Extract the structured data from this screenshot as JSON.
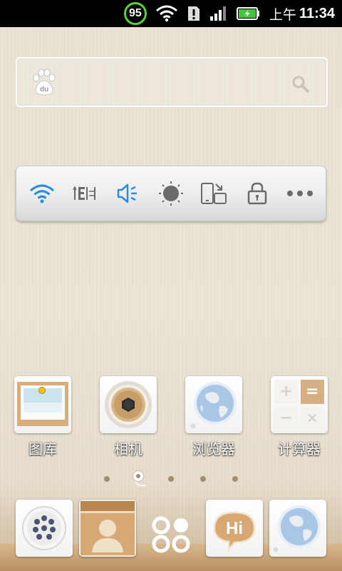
{
  "status_bar": {
    "battery_ring_value": "95",
    "ampm": "上午",
    "time": "11:34",
    "icons": [
      "wifi-icon",
      "sim-alert-icon",
      "signal-icon",
      "battery-charging-icon"
    ]
  },
  "search_widget": {
    "logo": "baidu-paw-icon",
    "logo_text": "du",
    "action_icon": "search-icon"
  },
  "toggles": [
    {
      "name": "wifi-toggle",
      "icon": "wifi-icon",
      "state": "on"
    },
    {
      "name": "data-toggle",
      "icon": "mobile-data-icon",
      "state": "off"
    },
    {
      "name": "sound-toggle",
      "icon": "speaker-icon",
      "state": "on"
    },
    {
      "name": "brightness-toggle",
      "icon": "brightness-icon",
      "state": "off"
    },
    {
      "name": "rotate-toggle",
      "icon": "rotate-icon",
      "state": "off"
    },
    {
      "name": "lock-toggle",
      "icon": "lock-icon",
      "state": "off"
    },
    {
      "name": "more-toggle",
      "icon": "more-icon",
      "state": "off"
    }
  ],
  "apps": [
    {
      "label": "图库",
      "icon": "gallery-icon"
    },
    {
      "label": "相机",
      "icon": "camera-icon"
    },
    {
      "label": "浏览器",
      "icon": "browser-icon"
    },
    {
      "label": "计算器",
      "icon": "calculator-icon"
    }
  ],
  "calculator_keys": [
    "+",
    "=",
    "−",
    "×"
  ],
  "pages": {
    "count": 5,
    "current": 2
  },
  "dock": [
    {
      "name": "phone",
      "icon": "dialpad-icon"
    },
    {
      "name": "contacts",
      "icon": "contacts-icon"
    },
    {
      "name": "app-drawer",
      "icon": "app-drawer-icon"
    },
    {
      "name": "messaging",
      "icon": "hi-message-icon",
      "text": "Hi"
    },
    {
      "name": "browser",
      "icon": "browser-icon"
    }
  ],
  "colors": {
    "accent_blue": "#2d8be0",
    "battery_green": "#5ad13a",
    "icon_gray": "#6a6a6a"
  }
}
